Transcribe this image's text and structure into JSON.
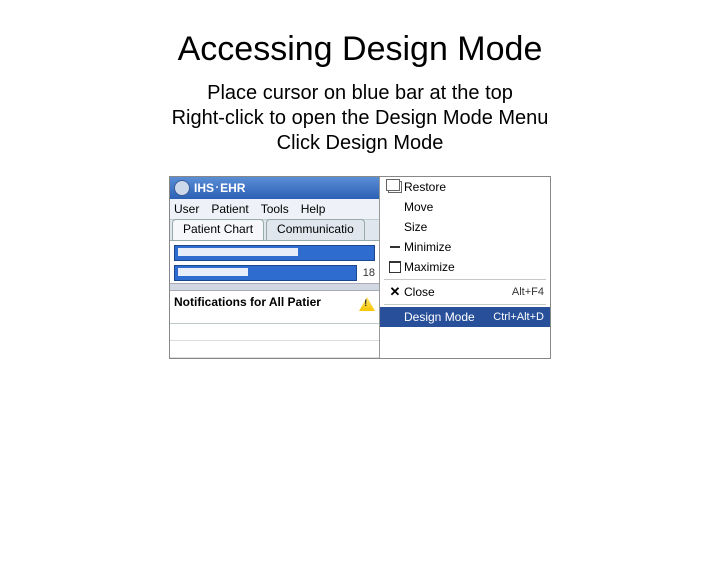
{
  "slide": {
    "title": "Accessing Design Mode",
    "line1": "Place cursor on blue bar at the top",
    "line2": "Right-click to open the Design Mode Menu",
    "line3": "Click Design Mode"
  },
  "titlebar": {
    "app": "IHS",
    "sep": "•",
    "sub": "EHR"
  },
  "menubar": {
    "user": "User",
    "patient": "Patient",
    "tools": "Tools",
    "help": "Help"
  },
  "tabs": {
    "chart": "Patient Chart",
    "comm": "Communicatio"
  },
  "panel": {
    "dob_abbrev": "18",
    "notif": "Notifications for All Patier"
  },
  "context_menu": {
    "restore": "Restore",
    "move": "Move",
    "size": "Size",
    "minimize": "Minimize",
    "maximize": "Maximize",
    "close": "Close",
    "close_shortcut": "Alt+F4",
    "design": "Design Mode",
    "design_shortcut": "Ctrl+Alt+D"
  }
}
